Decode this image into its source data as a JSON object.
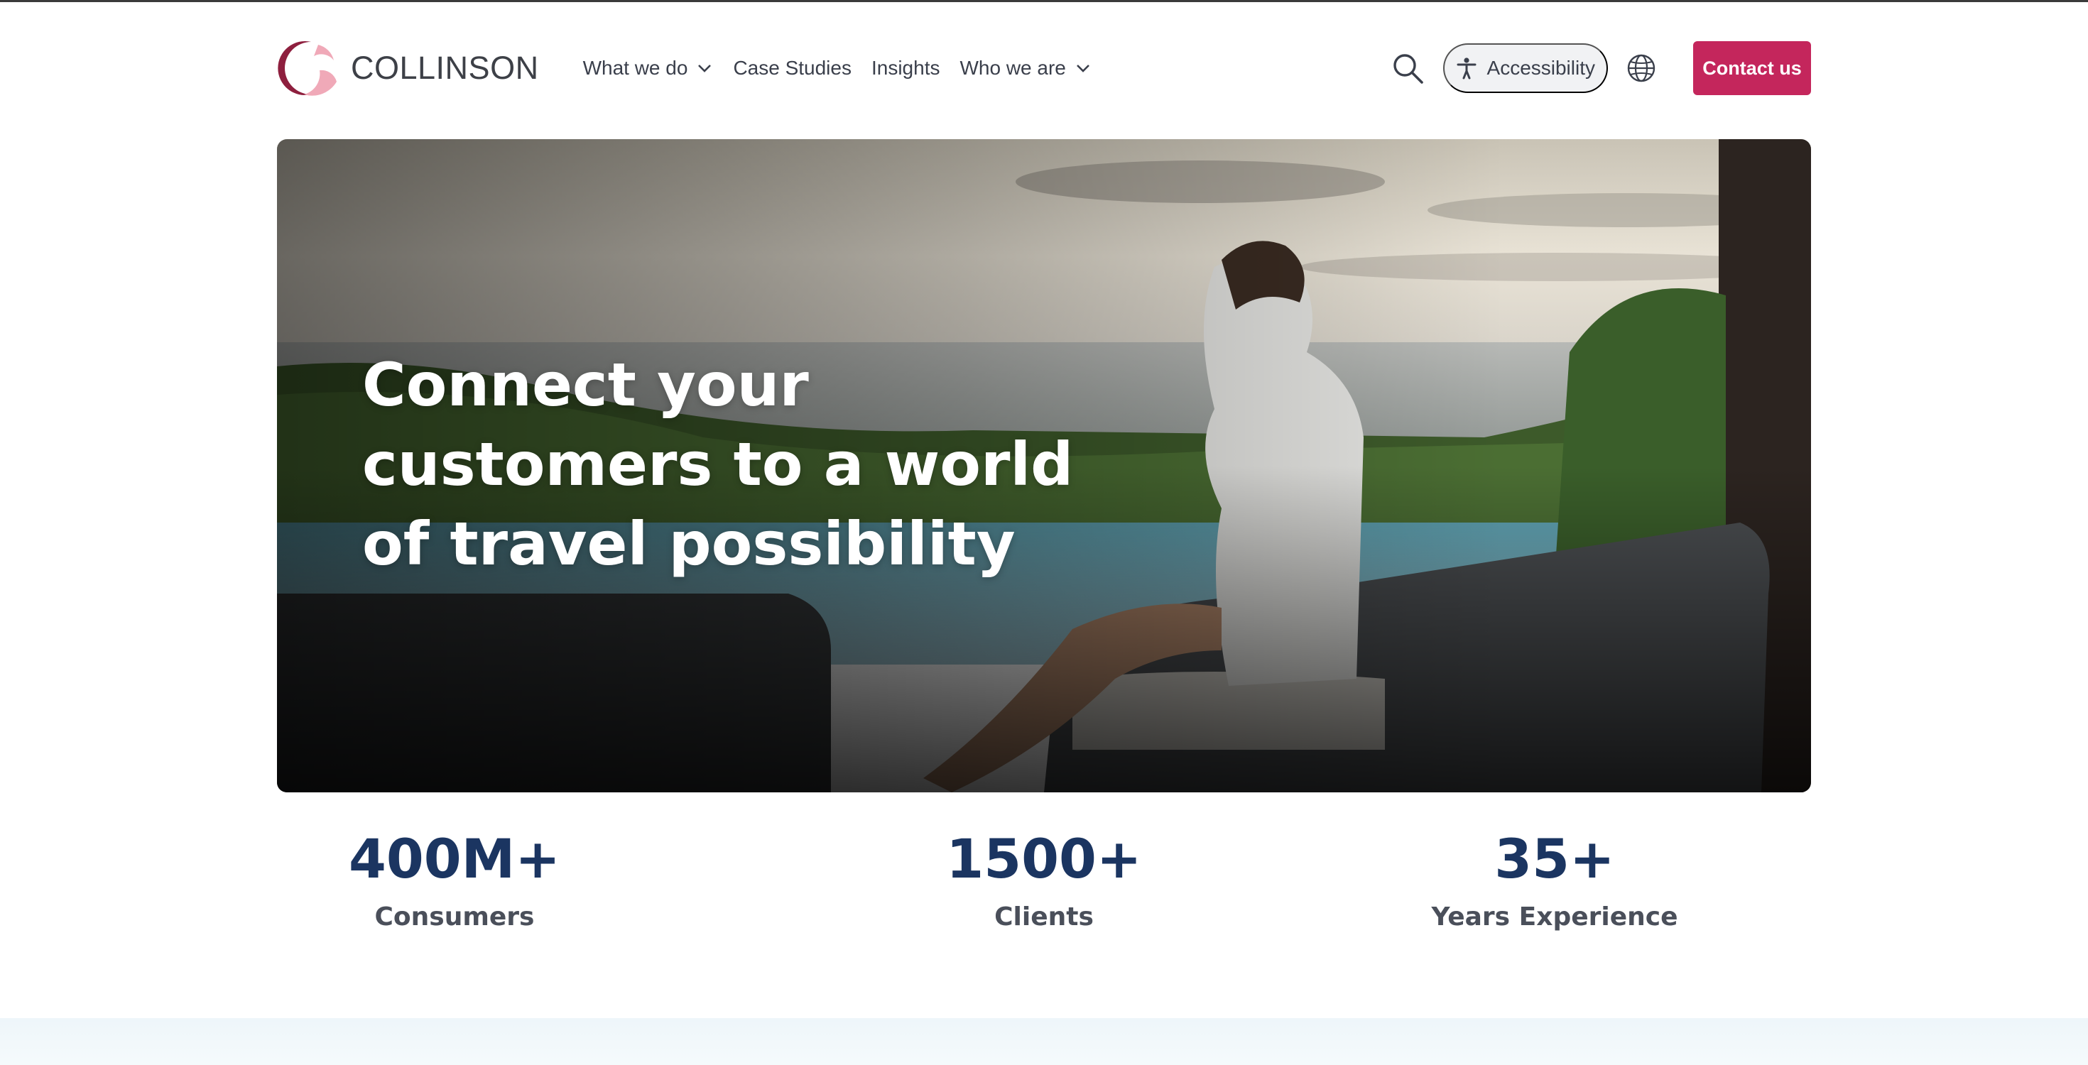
{
  "brand": {
    "name": "COLLINSON",
    "primary_color": "#c4265c",
    "logo_color_dark": "#8e1f3e",
    "logo_color_light": "#f0a9b8",
    "navy": "#1b3561"
  },
  "nav": {
    "items": [
      {
        "label": "What we do",
        "has_dropdown": true
      },
      {
        "label": "Case Studies",
        "has_dropdown": false
      },
      {
        "label": "Insights",
        "has_dropdown": false
      },
      {
        "label": "Who we are",
        "has_dropdown": true
      }
    ]
  },
  "header_actions": {
    "search_icon": "search-icon",
    "accessibility_label": "Accessibility",
    "accessibility_icon": "accessibility-person-icon",
    "language_icon": "globe-icon",
    "contact_label": "Contact us"
  },
  "hero": {
    "title": "Connect your customers to a world of travel possibility"
  },
  "stats": [
    {
      "value": "400M+",
      "label": "Consumers"
    },
    {
      "value": "1500+",
      "label": "Clients"
    },
    {
      "value": "35+",
      "label": "Years Experience"
    }
  ]
}
